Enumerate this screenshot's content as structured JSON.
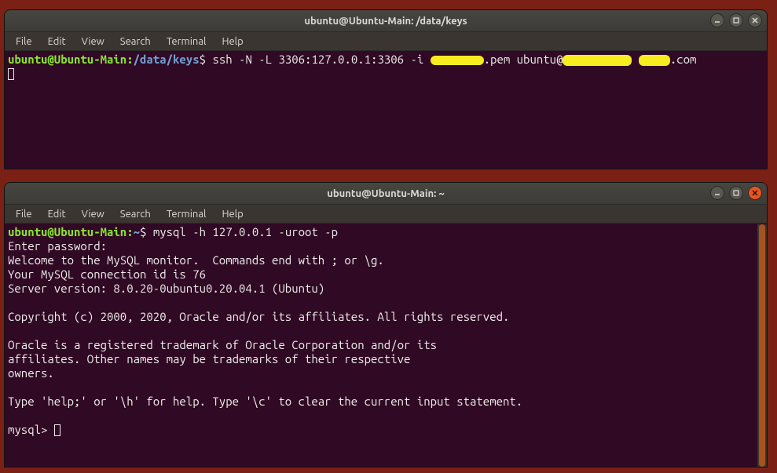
{
  "window1": {
    "title": "ubuntu@Ubuntu-Main: /data/keys",
    "menu": {
      "file": "File",
      "edit": "Edit",
      "view": "View",
      "search": "Search",
      "terminal": "Terminal",
      "help": "Help"
    },
    "prompt": {
      "userhost": "ubuntu@Ubuntu-Main",
      "colon": ":",
      "path": "/data/keys",
      "dollar": "$ "
    },
    "cmd_part1": "ssh -N -L 3306:127.0.0.1:3306 -i ",
    "cmd_part2": ".pem ubuntu@",
    "cmd_part3": ".com"
  },
  "window2": {
    "title": "ubuntu@Ubuntu-Main: ~",
    "menu": {
      "file": "File",
      "edit": "Edit",
      "view": "View",
      "search": "Search",
      "terminal": "Terminal",
      "help": "Help"
    },
    "prompt": {
      "userhost": "ubuntu@Ubuntu-Main",
      "colon": ":",
      "path": "~",
      "dollar": "$ "
    },
    "cmd": "mysql -h 127.0.0.1 -uroot -p",
    "lines": {
      "l1": "Enter password:",
      "l2": "Welcome to the MySQL monitor.  Commands end with ; or \\g.",
      "l3": "Your MySQL connection id is 76",
      "l4": "Server version: 8.0.20-0ubuntu0.20.04.1 (Ubuntu)",
      "l5": "",
      "l6": "Copyright (c) 2000, 2020, Oracle and/or its affiliates. All rights reserved.",
      "l7": "",
      "l8": "Oracle is a registered trademark of Oracle Corporation and/or its",
      "l9": "affiliates. Other names may be trademarks of their respective",
      "l10": "owners.",
      "l11": "",
      "l12": "Type 'help;' or '\\h' for help. Type '\\c' to clear the current input statement.",
      "l13": ""
    },
    "mysql_prompt": "mysql> "
  }
}
